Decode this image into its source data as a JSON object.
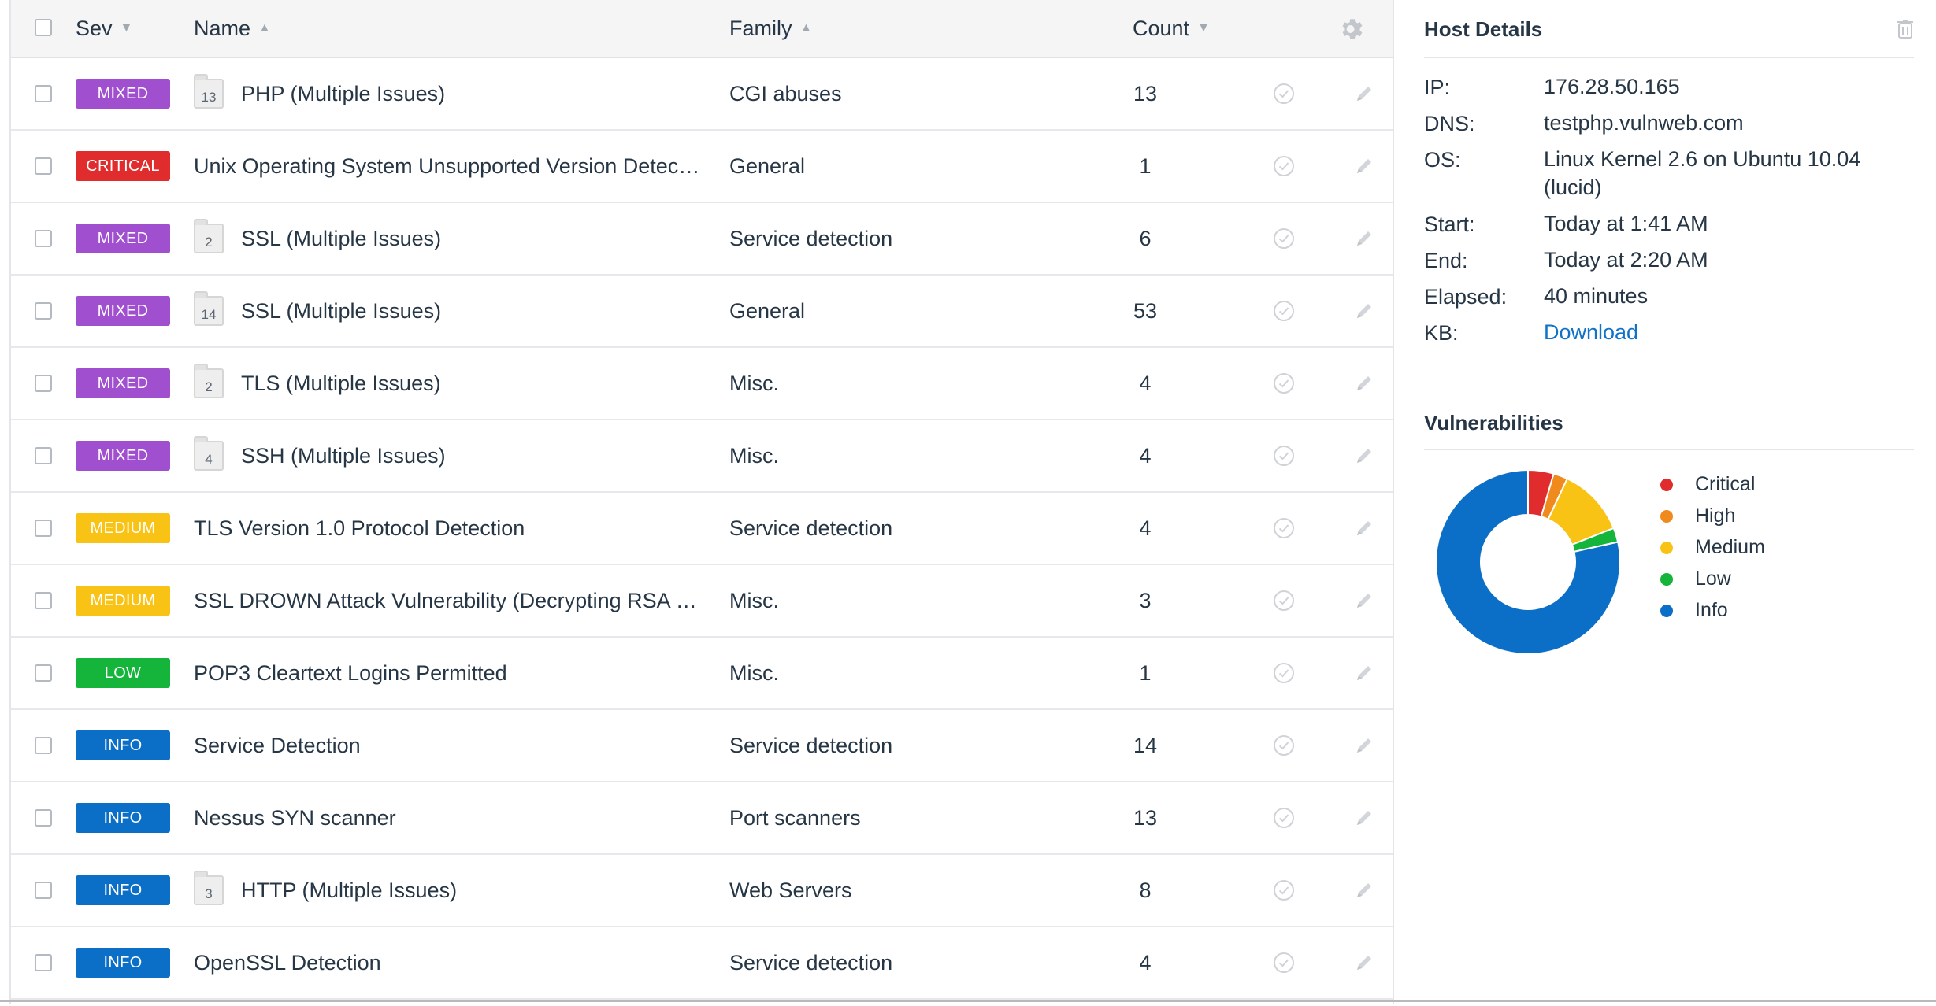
{
  "colors": {
    "mixed": "#a04fcf",
    "critical": "#e02c2c",
    "high": "#f08a1c",
    "medium": "#f9c315",
    "low": "#14b53a",
    "info": "#0b6fc7",
    "link": "#1173c7"
  },
  "table": {
    "headers": {
      "sev": "Sev",
      "name": "Name",
      "family": "Family",
      "count": "Count"
    },
    "header_icons": [
      "select-all-checkbox",
      "sort-desc-icon",
      "sort-asc-icon",
      "sort-asc-icon",
      "sort-desc-icon",
      "gear-icon"
    ],
    "rows": [
      {
        "sev": "MIXED",
        "sev_color": "#a04fcf",
        "group_count": "13",
        "name": "PHP (Multiple Issues)",
        "family": "CGI abuses",
        "count": "13"
      },
      {
        "sev": "CRITICAL",
        "sev_color": "#e02c2c",
        "group_count": "",
        "name": "Unix Operating System Unsupported Version Detection",
        "family": "General",
        "count": "1"
      },
      {
        "sev": "MIXED",
        "sev_color": "#a04fcf",
        "group_count": "2",
        "name": "SSL (Multiple Issues)",
        "family": "Service detection",
        "count": "6"
      },
      {
        "sev": "MIXED",
        "sev_color": "#a04fcf",
        "group_count": "14",
        "name": "SSL (Multiple Issues)",
        "family": "General",
        "count": "53"
      },
      {
        "sev": "MIXED",
        "sev_color": "#a04fcf",
        "group_count": "2",
        "name": "TLS (Multiple Issues)",
        "family": "Misc.",
        "count": "4"
      },
      {
        "sev": "MIXED",
        "sev_color": "#a04fcf",
        "group_count": "4",
        "name": "SSH (Multiple Issues)",
        "family": "Misc.",
        "count": "4"
      },
      {
        "sev": "MEDIUM",
        "sev_color": "#f9c315",
        "group_count": "",
        "name": "TLS Version 1.0 Protocol Detection",
        "family": "Service detection",
        "count": "4"
      },
      {
        "sev": "MEDIUM",
        "sev_color": "#f9c315",
        "group_count": "",
        "name": "SSL DROWN Attack Vulnerability (Decrypting RSA wi…",
        "family": "Misc.",
        "count": "3"
      },
      {
        "sev": "LOW",
        "sev_color": "#14b53a",
        "group_count": "",
        "name": "POP3 Cleartext Logins Permitted",
        "family": "Misc.",
        "count": "1"
      },
      {
        "sev": "INFO",
        "sev_color": "#0b6fc7",
        "group_count": "",
        "name": "Service Detection",
        "family": "Service detection",
        "count": "14"
      },
      {
        "sev": "INFO",
        "sev_color": "#0b6fc7",
        "group_count": "",
        "name": "Nessus SYN scanner",
        "family": "Port scanners",
        "count": "13"
      },
      {
        "sev": "INFO",
        "sev_color": "#0b6fc7",
        "group_count": "3",
        "name": "HTTP (Multiple Issues)",
        "family": "Web Servers",
        "count": "8"
      },
      {
        "sev": "INFO",
        "sev_color": "#0b6fc7",
        "group_count": "",
        "name": "OpenSSL Detection",
        "family": "Service detection",
        "count": "4"
      }
    ]
  },
  "host_details": {
    "title": "Host Details",
    "fields": [
      {
        "label": "IP:",
        "value": "176.28.50.165"
      },
      {
        "label": "DNS:",
        "value": "testphp.vulnweb.com"
      },
      {
        "label": "OS:",
        "value": "Linux Kernel 2.6 on Ubuntu 10.04 (lucid)"
      },
      {
        "label": "Start:",
        "value": "Today at 1:41 AM"
      },
      {
        "label": "End:",
        "value": "Today at 2:20 AM"
      },
      {
        "label": "Elapsed:",
        "value": "40 minutes"
      },
      {
        "label": "KB:",
        "value": "Download",
        "link": true
      }
    ]
  },
  "vulnerabilities": {
    "title": "Vulnerabilities",
    "legend": [
      {
        "label": "Critical",
        "color": "#e02c2c"
      },
      {
        "label": "High",
        "color": "#f08a1c"
      },
      {
        "label": "Medium",
        "color": "#f9c315"
      },
      {
        "label": "Low",
        "color": "#14b53a"
      },
      {
        "label": "Info",
        "color": "#0b6fc7"
      }
    ],
    "chart_data": {
      "type": "pie",
      "categories": [
        "Critical",
        "High",
        "Medium",
        "Low",
        "Info"
      ],
      "values": [
        4.5,
        2.5,
        12,
        2.5,
        78.5
      ],
      "title": "Vulnerabilities",
      "legend_position": "right"
    }
  }
}
